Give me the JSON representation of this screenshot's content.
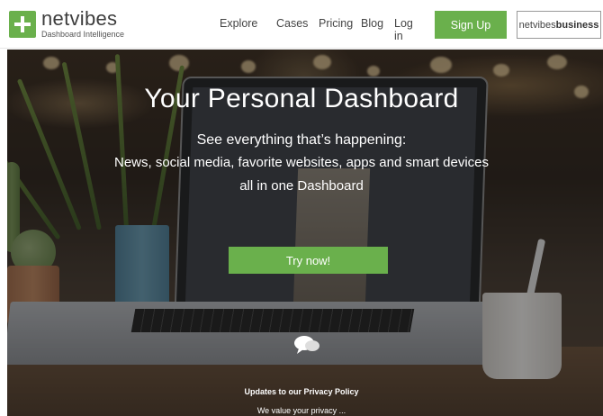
{
  "brand": {
    "name": "netvibes",
    "tagline": "Dashboard Intelligence",
    "accent_color": "#6ab04c"
  },
  "nav": {
    "items": [
      "Explore",
      "Cases",
      "Pricing",
      "Blog",
      "Log in"
    ],
    "signup_label": "Sign Up",
    "business_prefix": "netvibes",
    "business_bold": "business"
  },
  "hero": {
    "title": "Your Personal Dashboard",
    "subtitle_1": "See everything that’s happening:",
    "subtitle_2": "News, social media, favorite websites, apps and smart devices",
    "subtitle_3": "all in one Dashboard",
    "cta_label": "Try now!"
  },
  "privacy": {
    "title": "Updates to our Privacy Policy",
    "text": "We value your privacy ..."
  },
  "icons": {
    "logo": "plus-icon",
    "chat": "chat-bubbles-icon"
  }
}
